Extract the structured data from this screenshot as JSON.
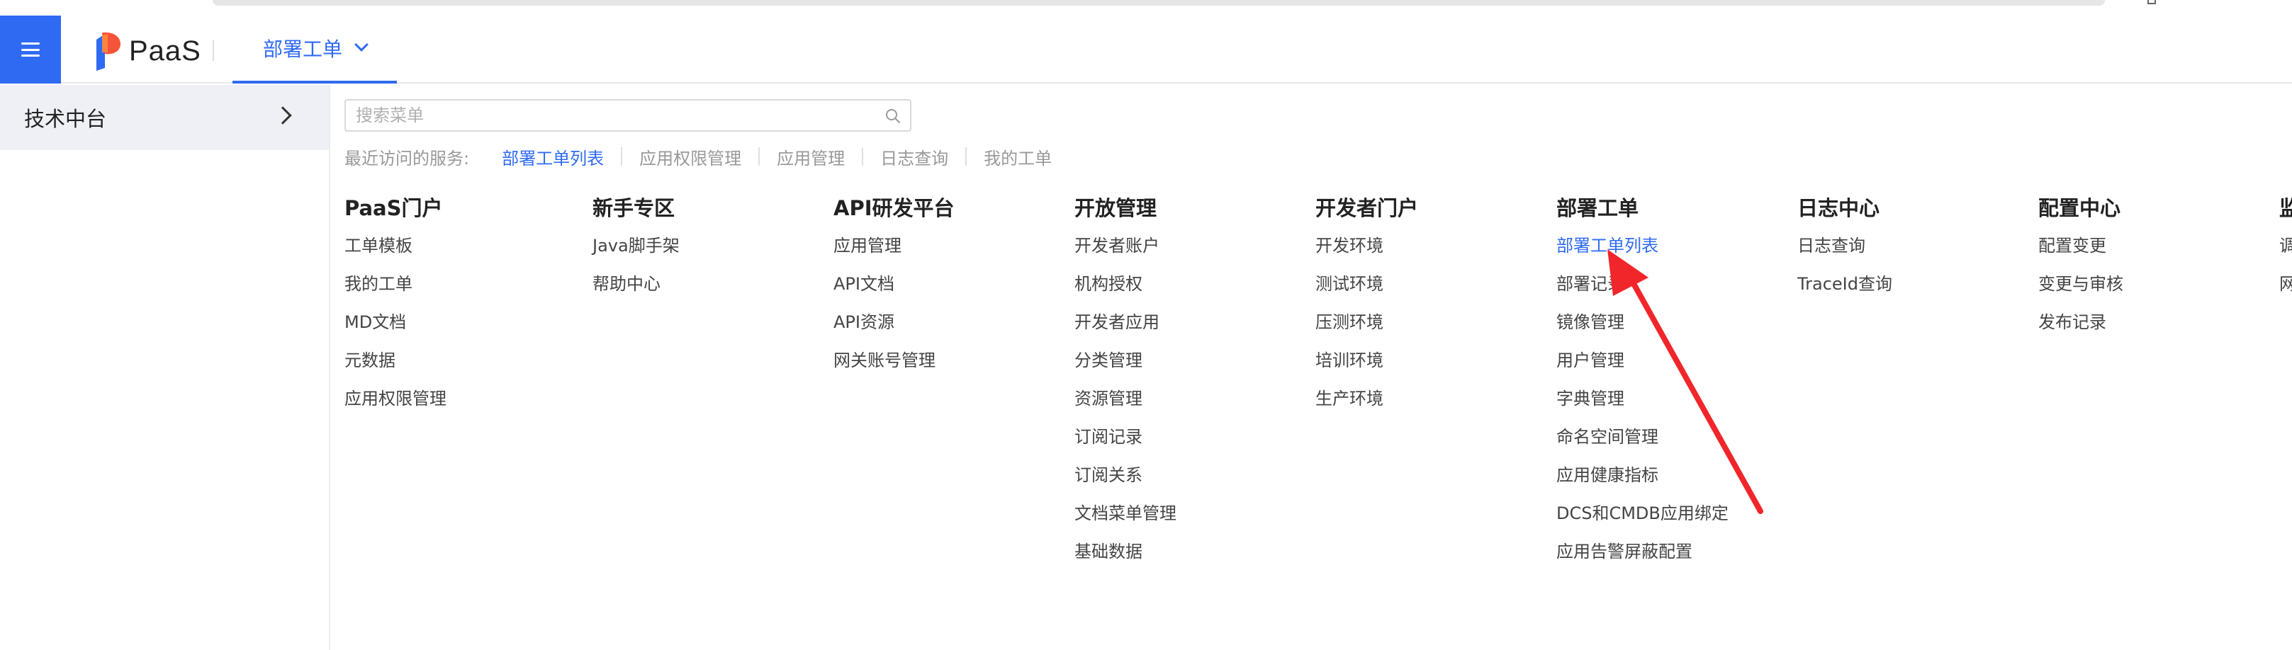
{
  "topbar": {
    "logo_text": "PaaS",
    "tab_label": "部署工单"
  },
  "sidebar": {
    "items": [
      {
        "label": "技术中台"
      }
    ]
  },
  "search": {
    "placeholder": "搜索菜单"
  },
  "recent": {
    "prefix": "最近访问的服务:",
    "items": [
      "部署工单列表",
      "应用权限管理",
      "应用管理",
      "日志查询",
      "我的工单"
    ]
  },
  "columns": [
    {
      "title": "PaaS门户",
      "links": [
        "工单模板",
        "我的工单",
        "MD文档",
        "元数据",
        "应用权限管理"
      ]
    },
    {
      "title": "新手专区",
      "links": [
        "Java脚手架",
        "帮助中心"
      ]
    },
    {
      "title": "API研发平台",
      "links": [
        "应用管理",
        "API文档",
        "API资源",
        "网关账号管理"
      ]
    },
    {
      "title": "开放管理",
      "links": [
        "开发者账户",
        "机构授权",
        "开发者应用",
        "分类管理",
        "资源管理",
        "订阅记录",
        "订阅关系",
        "文档菜单管理",
        "基础数据"
      ]
    },
    {
      "title": "开发者门户",
      "links": [
        "开发环境",
        "测试环境",
        "压测环境",
        "培训环境",
        "生产环境"
      ]
    },
    {
      "title": "部署工单",
      "links": [
        "部署工单列表",
        "部署记录",
        "镜像管理",
        "用户管理",
        "字典管理",
        "命名空间管理",
        "应用健康指标",
        "DCS和CMDB应用绑定",
        "应用告警屏蔽配置"
      ]
    },
    {
      "title": "日志中心",
      "links": [
        "日志查询",
        "TraceId查询"
      ]
    },
    {
      "title": "配置中心",
      "links": [
        "配置变更",
        "变更与审核",
        "发布记录"
      ]
    },
    {
      "title": "监",
      "links": [
        "调",
        "网"
      ]
    }
  ],
  "colors": {
    "accent": "#2f6bf2",
    "annotation_arrow": "#f0262a"
  },
  "icons": {
    "menu": "hamburger-menu-icon",
    "search": "search-icon",
    "chevron_down": "chevron-down-icon",
    "chevron_right": "chevron-right-icon"
  }
}
